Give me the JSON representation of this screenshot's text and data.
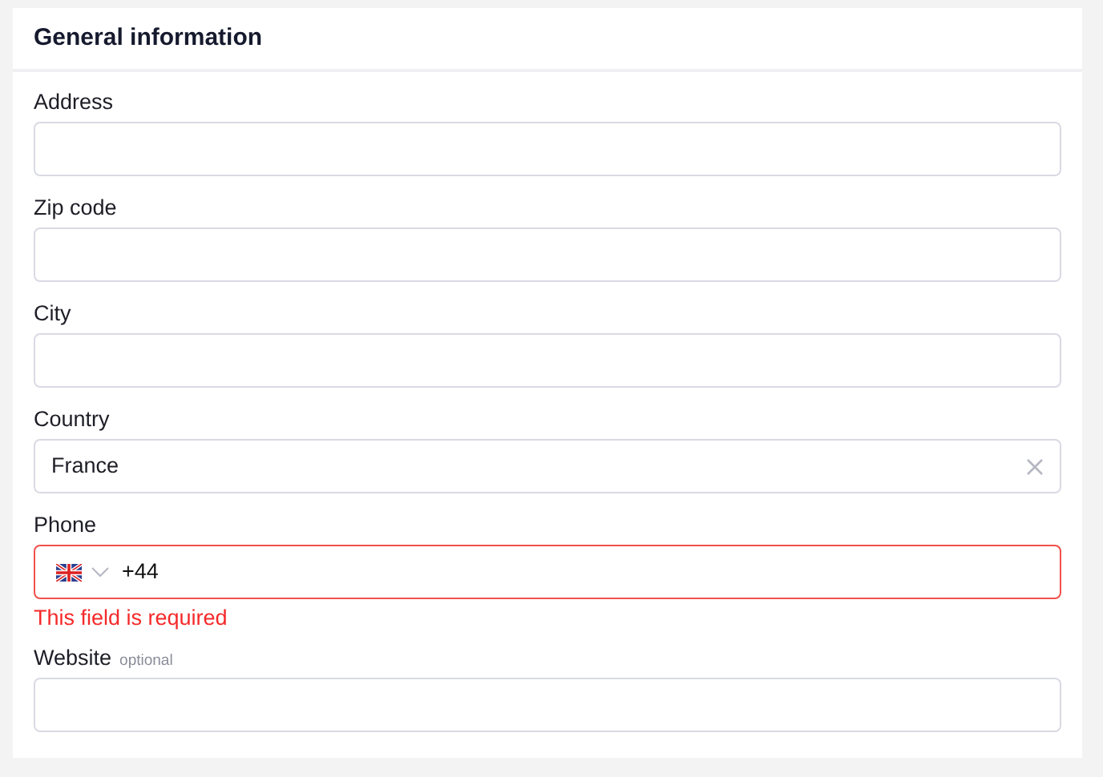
{
  "section": {
    "title": "General information"
  },
  "fields": [
    {
      "kind": "text",
      "label": "Address"
    },
    {
      "kind": "text",
      "label": "Zip code"
    },
    {
      "kind": "text",
      "label": "City"
    },
    {
      "kind": "select",
      "label": "Country",
      "value": "France"
    },
    {
      "kind": "phone",
      "label": "Phone",
      "value": "+44",
      "error": "This field is required"
    },
    {
      "kind": "text",
      "label": "Website",
      "hint": "optional"
    }
  ]
}
